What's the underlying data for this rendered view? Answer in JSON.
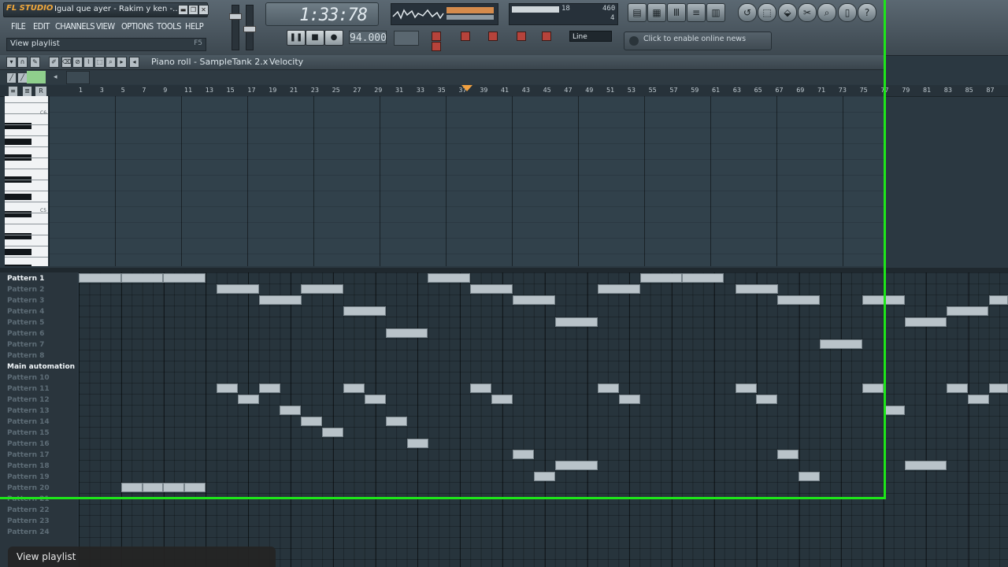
{
  "app": {
    "logo": "FL STUDIO",
    "window_title": "Igual que ayer - Rakim y ken -...",
    "window_buttons": [
      "▬",
      "❐",
      "✕"
    ]
  },
  "menu": [
    "FILE",
    "EDIT",
    "CHANNELS",
    "VIEW",
    "OPTIONS",
    "TOOLS",
    "HELP"
  ],
  "hint": {
    "text": "View playlist",
    "key": "F5"
  },
  "time_display": {
    "value": "1:33:78"
  },
  "tempo": {
    "value": "94.000"
  },
  "meters": {
    "voices": "18",
    "mem": "460",
    "poly": "4"
  },
  "snap": {
    "value": "Line"
  },
  "news": {
    "text": "Click to enable online news"
  },
  "piano_roll": {
    "title": "Piano roll - SampleTank 2.x",
    "target": "Velocity",
    "ruler": [
      "1",
      "3",
      "5",
      "7",
      "9",
      "11",
      "13",
      "15",
      "17",
      "19",
      "21",
      "23",
      "25",
      "27",
      "29",
      "31",
      "33",
      "35",
      "37",
      "39",
      "41",
      "43",
      "45",
      "47",
      "49",
      "51",
      "53",
      "55",
      "57",
      "59",
      "61",
      "63",
      "65",
      "67",
      "69",
      "71",
      "73",
      "75",
      "77",
      "79",
      "81",
      "83",
      "85",
      "87"
    ],
    "key_labels": [
      "C6",
      "C5"
    ]
  },
  "playlist": {
    "rows": [
      "Pattern 1",
      "Pattern 2",
      "Pattern 3",
      "Pattern 4",
      "Pattern 5",
      "Pattern 6",
      "Pattern 7",
      "Pattern 8",
      "Main automation",
      "Pattern 10",
      "Pattern 11",
      "Pattern 12",
      "Pattern 13",
      "Pattern 14",
      "Pattern 15",
      "Pattern 16",
      "Pattern 17",
      "Pattern 18",
      "Pattern 19",
      "Pattern 20",
      "Pattern 21",
      "Pattern 22",
      "Pattern 23",
      "Pattern 24"
    ],
    "active_rows": [
      0,
      8
    ]
  },
  "tooltip": {
    "text": "View playlist"
  }
}
